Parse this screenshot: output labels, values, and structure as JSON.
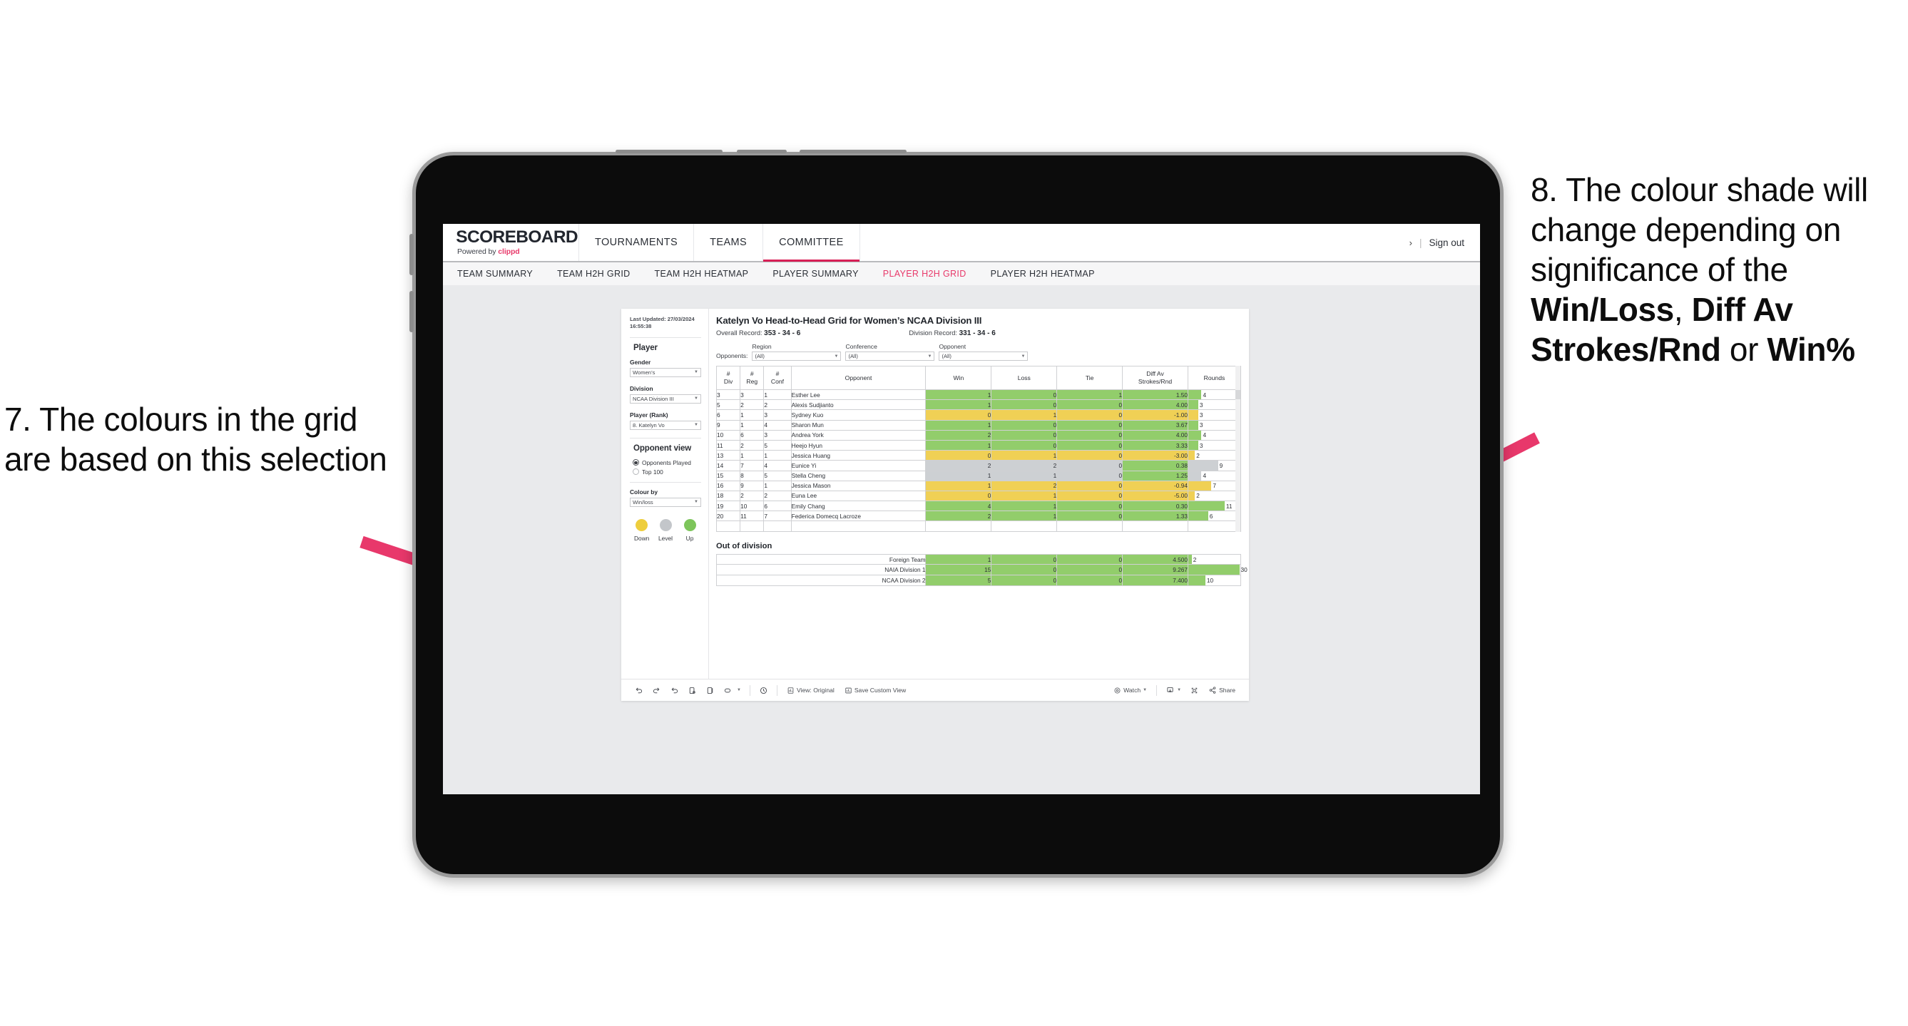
{
  "annotations": {
    "left": {
      "id": "annotation-7",
      "text": "7. The colours in the grid are based on this selection"
    },
    "right": {
      "id": "annotation-8",
      "lead": "8. The colour shade will change depending on significance of the ",
      "bold1": "Win/Loss",
      "mid1": ", ",
      "bold2": "Diff Av Strokes/Rnd",
      "mid2": " or ",
      "bold3": "Win%"
    },
    "arrow_color": "#e8386b"
  },
  "app": {
    "logo": {
      "main": "SCOREBOARD",
      "sub_prefix": "Powered by ",
      "sub_brand": "clippd"
    },
    "accent": "#d81f56",
    "topnav": [
      {
        "label": "TOURNAMENTS",
        "active": false
      },
      {
        "label": "TEAMS",
        "active": false
      },
      {
        "label": "COMMITTEE",
        "active": true
      }
    ],
    "header_right": {
      "chevron": "›",
      "divider": "|",
      "signout": "Sign out"
    },
    "subnav": [
      {
        "label": "TEAM SUMMARY",
        "active": false
      },
      {
        "label": "TEAM H2H GRID",
        "active": false
      },
      {
        "label": "TEAM H2H HEATMAP",
        "active": false
      },
      {
        "label": "PLAYER SUMMARY",
        "active": false
      },
      {
        "label": "PLAYER H2H GRID",
        "active": true
      },
      {
        "label": "PLAYER H2H HEATMAP",
        "active": false
      }
    ]
  },
  "sidebar": {
    "last_updated": "Last Updated: 27/03/2024 16:55:38",
    "player_heading": "Player",
    "gender": {
      "label": "Gender",
      "value": "Women’s"
    },
    "division": {
      "label": "Division",
      "value": "NCAA Division III"
    },
    "player_rank": {
      "label": "Player (Rank)",
      "value": "8. Katelyn Vo"
    },
    "opponent_view": {
      "heading": "Opponent view",
      "options": [
        {
          "label": "Opponents Played",
          "selected": true
        },
        {
          "label": "Top 100",
          "selected": false
        }
      ]
    },
    "colour_by": {
      "label": "Colour by",
      "value": "Win/loss"
    },
    "legend": [
      {
        "label": "Down",
        "color": "#eece3d"
      },
      {
        "label": "Level",
        "color": "#c3c6ca"
      },
      {
        "label": "Up",
        "color": "#7dc55b"
      }
    ]
  },
  "main": {
    "title": "Katelyn Vo Head-to-Head Grid for Women’s NCAA Division III",
    "overall_record_label": "Overall Record: ",
    "overall_record_value": "353 -  34 - 6",
    "division_record_label": "Division Record: ",
    "division_record_value": "331 -  34 - 6",
    "opponents_label": "Opponents:",
    "filters": [
      {
        "caption": "Region",
        "value": "(All)"
      },
      {
        "caption": "Conference",
        "value": "(All)"
      },
      {
        "caption": "Opponent",
        "value": "(All)"
      }
    ],
    "out_of_division_title": "Out of division"
  },
  "chart_data": {
    "type": "table",
    "title": "Katelyn Vo Head-to-Head Grid for Women’s NCAA Division III",
    "columns": [
      "# Div",
      "# Reg",
      "# Conf",
      "Opponent",
      "Win",
      "Loss",
      "Tie",
      "Diff Av Strokes/Rnd",
      "Rounds"
    ],
    "column_headers_multiline": [
      [
        "#",
        "Div"
      ],
      [
        "#",
        "Reg"
      ],
      [
        "#",
        "Conf"
      ],
      [
        "Opponent"
      ],
      [
        "Win"
      ],
      [
        "Loss"
      ],
      [
        "Tie"
      ],
      [
        "Diff Av",
        "Strokes/Rnd"
      ],
      [
        "Rounds"
      ]
    ],
    "rows": [
      {
        "div": "3",
        "reg": "3",
        "conf": "1",
        "opponent": "Esther Lee",
        "win": "1",
        "loss": "0",
        "tie": "1",
        "diff": "1.50",
        "rounds": "4",
        "state": "up"
      },
      {
        "div": "5",
        "reg": "2",
        "conf": "2",
        "opponent": "Alexis Sudjianto",
        "win": "1",
        "loss": "0",
        "tie": "0",
        "diff": "4.00",
        "rounds": "3",
        "state": "up"
      },
      {
        "div": "6",
        "reg": "1",
        "conf": "3",
        "opponent": "Sydney Kuo",
        "win": "0",
        "loss": "1",
        "tie": "0",
        "diff": "-1.00",
        "rounds": "3",
        "state": "down"
      },
      {
        "div": "9",
        "reg": "1",
        "conf": "4",
        "opponent": "Sharon Mun",
        "win": "1",
        "loss": "0",
        "tie": "0",
        "diff": "3.67",
        "rounds": "3",
        "state": "up"
      },
      {
        "div": "10",
        "reg": "6",
        "conf": "3",
        "opponent": "Andrea York",
        "win": "2",
        "loss": "0",
        "tie": "0",
        "diff": "4.00",
        "rounds": "4",
        "state": "up"
      },
      {
        "div": "11",
        "reg": "2",
        "conf": "5",
        "opponent": "Heejo Hyun",
        "win": "1",
        "loss": "0",
        "tie": "0",
        "diff": "3.33",
        "rounds": "3",
        "state": "up"
      },
      {
        "div": "13",
        "reg": "1",
        "conf": "1",
        "opponent": "Jessica Huang",
        "win": "0",
        "loss": "1",
        "tie": "0",
        "diff": "-3.00",
        "rounds": "2",
        "state": "down"
      },
      {
        "div": "14",
        "reg": "7",
        "conf": "4",
        "opponent": "Eunice Yi",
        "win": "2",
        "loss": "2",
        "tie": "0",
        "diff": "0.38",
        "rounds": "9",
        "state": "level",
        "diff_state": "up"
      },
      {
        "div": "15",
        "reg": "8",
        "conf": "5",
        "opponent": "Stella Cheng",
        "win": "1",
        "loss": "1",
        "tie": "0",
        "diff": "1.25",
        "rounds": "4",
        "state": "level",
        "diff_state": "up"
      },
      {
        "div": "16",
        "reg": "9",
        "conf": "1",
        "opponent": "Jessica Mason",
        "win": "1",
        "loss": "2",
        "tie": "0",
        "diff": "-0.94",
        "rounds": "7",
        "state": "down"
      },
      {
        "div": "18",
        "reg": "2",
        "conf": "2",
        "opponent": "Euna Lee",
        "win": "0",
        "loss": "1",
        "tie": "0",
        "diff": "-5.00",
        "rounds": "2",
        "state": "down"
      },
      {
        "div": "19",
        "reg": "10",
        "conf": "6",
        "opponent": "Emily Chang",
        "win": "4",
        "loss": "1",
        "tie": "0",
        "diff": "0.30",
        "rounds": "11",
        "state": "up"
      },
      {
        "div": "20",
        "reg": "11",
        "conf": "7",
        "opponent": "Federica Domecq Lacroze",
        "win": "2",
        "loss": "1",
        "tie": "0",
        "diff": "1.33",
        "rounds": "6",
        "state": "up"
      }
    ],
    "out_of_division": {
      "title": "Out of division",
      "rows": [
        {
          "name": "Foreign Team",
          "win": "1",
          "loss": "0",
          "tie": "0",
          "diff": "4.500",
          "rounds": "2",
          "state": "up"
        },
        {
          "name": "NAIA Division 1",
          "win": "15",
          "loss": "0",
          "tie": "0",
          "diff": "9.267",
          "rounds": "30",
          "state": "up"
        },
        {
          "name": "NCAA Division 2",
          "win": "5",
          "loss": "0",
          "tie": "0",
          "diff": "7.400",
          "rounds": "10",
          "state": "up"
        }
      ]
    },
    "colors": {
      "up": "#92cd6b",
      "down": "#f0d055",
      "level": "#cdd0d3"
    }
  },
  "toolbar": {
    "view_label": "View: Original",
    "save_label": "Save Custom View",
    "watch_label": "Watch",
    "share_label": "Share"
  }
}
